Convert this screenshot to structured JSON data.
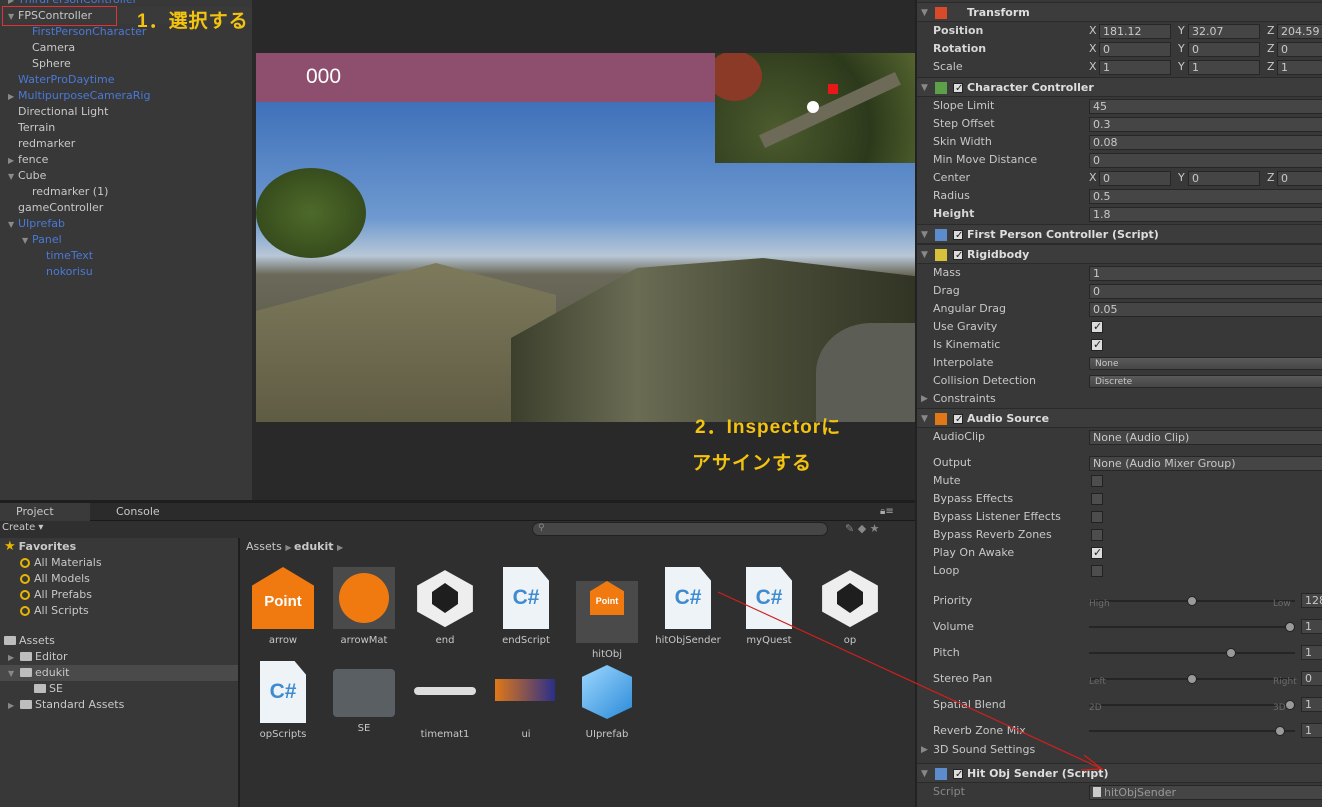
{
  "hierarchy": {
    "items": [
      {
        "label": "ThirdPersonController",
        "color": "blue",
        "indent": 0,
        "arrow": "right"
      },
      {
        "label": "FPSController",
        "color": "white",
        "indent": 0,
        "arrow": "down"
      },
      {
        "label": "FirstPersonCharacter",
        "color": "blue",
        "indent": 1,
        "arrow": ""
      },
      {
        "label": "Camera",
        "color": "white",
        "indent": 1,
        "arrow": ""
      },
      {
        "label": "Sphere",
        "color": "white",
        "indent": 1,
        "arrow": ""
      },
      {
        "label": "WaterProDaytime",
        "color": "blue",
        "indent": 0,
        "arrow": ""
      },
      {
        "label": "MultipurposeCameraRig",
        "color": "blue",
        "indent": 0,
        "arrow": "right"
      },
      {
        "label": "Directional Light",
        "color": "white",
        "indent": 0,
        "arrow": ""
      },
      {
        "label": "Terrain",
        "color": "white",
        "indent": 0,
        "arrow": ""
      },
      {
        "label": "redmarker",
        "color": "white",
        "indent": 0,
        "arrow": ""
      },
      {
        "label": "fence",
        "color": "white",
        "indent": 0,
        "arrow": "right"
      },
      {
        "label": "Cube",
        "color": "white",
        "indent": 0,
        "arrow": "down"
      },
      {
        "label": "redmarker (1)",
        "color": "white",
        "indent": 1,
        "arrow": ""
      },
      {
        "label": "gameController",
        "color": "white",
        "indent": 0,
        "arrow": ""
      },
      {
        "label": "UIprefab",
        "color": "blue",
        "indent": 0,
        "arrow": "down"
      },
      {
        "label": "Panel",
        "color": "blue",
        "indent": 1,
        "arrow": "down"
      },
      {
        "label": "timeText",
        "color": "blue",
        "indent": 2,
        "arrow": ""
      },
      {
        "label": "nokorisu",
        "color": "blue",
        "indent": 2,
        "arrow": ""
      }
    ]
  },
  "annotations": {
    "step1": "1．選択する",
    "step2_line1": "2．Inspectorに",
    "step2_line2": "アサインする"
  },
  "game": {
    "timer": "000"
  },
  "project": {
    "tab_project": "Project",
    "tab_console": "Console",
    "create_label": "Create ▾",
    "favorites_label": "Favorites",
    "favorites": [
      "All Materials",
      "All Models",
      "All Prefabs",
      "All Scripts"
    ],
    "assets_label": "Assets",
    "folders": [
      {
        "label": "Editor",
        "indent": 1,
        "arrow": "▶",
        "selected": false
      },
      {
        "label": "edukit",
        "indent": 1,
        "arrow": "▼",
        "selected": true
      },
      {
        "label": "SE",
        "indent": 2,
        "arrow": "",
        "selected": false
      },
      {
        "label": "Standard Assets",
        "indent": 1,
        "arrow": "▶",
        "selected": false
      }
    ],
    "breadcrumb_root": "Assets",
    "breadcrumb_current": "edukit",
    "assets": [
      {
        "label": "arrow",
        "kind": "point"
      },
      {
        "label": "arrowMat",
        "kind": "arrowmat"
      },
      {
        "label": "end",
        "kind": "unity"
      },
      {
        "label": "endScript",
        "kind": "cs"
      },
      {
        "label": "hitObj",
        "kind": "pointsmall"
      },
      {
        "label": "hitObjSender",
        "kind": "cs"
      },
      {
        "label": "myQuest",
        "kind": "cs"
      },
      {
        "label": "op",
        "kind": "unity"
      },
      {
        "label": "opScripts",
        "kind": "cs"
      },
      {
        "label": "SE",
        "kind": "folder"
      },
      {
        "label": "timemat1",
        "kind": "slider"
      },
      {
        "label": "ui",
        "kind": "uiimg"
      },
      {
        "label": "UIprefab",
        "kind": "cube"
      }
    ],
    "point_text": "Point",
    "cs_text": "C#"
  },
  "inspector": {
    "transform": {
      "title": "Transform",
      "position_label": "Position",
      "rotation_label": "Rotation",
      "scale_label": "Scale",
      "position": [
        "181.12",
        "32.07",
        "204.59"
      ],
      "rotation": [
        "0",
        "0",
        "0"
      ],
      "scale": [
        "1",
        "1",
        "1"
      ]
    },
    "character_controller": {
      "title": "Character Controller",
      "rows": [
        {
          "label": "Slope Limit",
          "value": "45"
        },
        {
          "label": "Step Offset",
          "value": "0.3"
        },
        {
          "label": "Skin Width",
          "value": "0.08"
        },
        {
          "label": "Min Move Distance",
          "value": "0"
        }
      ],
      "center_label": "Center",
      "center": [
        "0",
        "0",
        "0"
      ],
      "radius_label": "Radius",
      "radius": "0.5",
      "height_label": "Height",
      "height": "1.8"
    },
    "fpc": {
      "title": "First Person Controller (Script)"
    },
    "rigidbody": {
      "title": "Rigidbody",
      "mass_label": "Mass",
      "mass": "1",
      "drag_label": "Drag",
      "drag": "0",
      "angular_drag_label": "Angular Drag",
      "angular_drag": "0.05",
      "use_gravity_label": "Use Gravity",
      "is_kinematic_label": "Is Kinematic",
      "interpolate_label": "Interpolate",
      "interpolate": "None",
      "collision_label": "Collision Detection",
      "collision": "Discrete",
      "constraints_label": "Constraints"
    },
    "audio": {
      "title": "Audio Source",
      "clip_label": "AudioClip",
      "clip": "None (Audio Clip)",
      "output_label": "Output",
      "output": "None (Audio Mixer Group)",
      "checks": [
        {
          "label": "Mute",
          "on": false
        },
        {
          "label": "Bypass Effects",
          "on": false
        },
        {
          "label": "Bypass Listener Effects",
          "on": false
        },
        {
          "label": "Bypass Reverb Zones",
          "on": false
        },
        {
          "label": "Play On Awake",
          "on": true
        },
        {
          "label": "Loop",
          "on": false
        }
      ],
      "priority_label": "Priority",
      "priority": "128",
      "priority_low": "High",
      "priority_high": "Low",
      "volume_label": "Volume",
      "volume": "1",
      "pitch_label": "Pitch",
      "pitch": "1",
      "pan_label": "Stereo Pan",
      "pan": "0",
      "pan_left": "Left",
      "pan_right": "Right",
      "spatial_label": "Spatial Blend",
      "spatial": "1",
      "spatial_2d": "2D",
      "spatial_3d": "3D",
      "reverb_label": "Reverb Zone Mix",
      "reverb": "1",
      "sound3d_label": "3D Sound Settings"
    },
    "hitobj": {
      "title": "Hit Obj Sender (Script)",
      "script_label": "Script",
      "script": "hitObjSender"
    }
  },
  "colors": {
    "accent_annotation": "#f3c30f",
    "selection_box": "#e0323a",
    "arrow_line": "#d0201c"
  }
}
